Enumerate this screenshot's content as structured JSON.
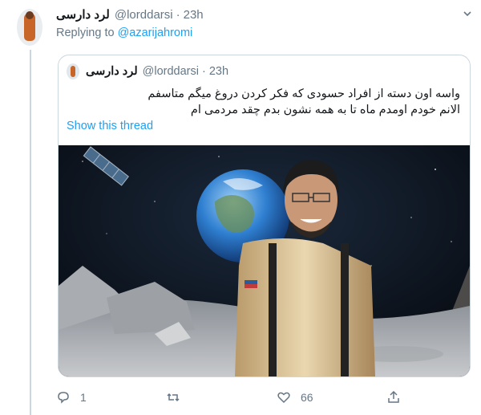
{
  "tweet": {
    "display_name": "لرد دارسی",
    "handle": "@lorddarsi",
    "separator": "·",
    "time": "23h",
    "replying_prefix": "Replying to ",
    "replying_handle": "@azarijahromi"
  },
  "quote": {
    "display_name": "لرد دارسی",
    "handle": "@lorddarsi",
    "separator": "·",
    "time": "23h",
    "text_line1": "واسه اون دسته از افراد حسودی که فکر کردن دروغ میگم متاسفم",
    "text_line2": "الانم خودم اومدم ماه تا به همه نشون بدم چقد مردمی ام",
    "show_thread": "Show this thread"
  },
  "actions": {
    "reply_count": "1",
    "retweet_count": "",
    "like_count": "66"
  },
  "colors": {
    "accent": "#1da1f2",
    "muted": "#657786",
    "border": "#ccd6dd"
  },
  "icons": [
    "caret-down-icon",
    "reply-icon",
    "retweet-icon",
    "like-icon",
    "share-icon"
  ]
}
